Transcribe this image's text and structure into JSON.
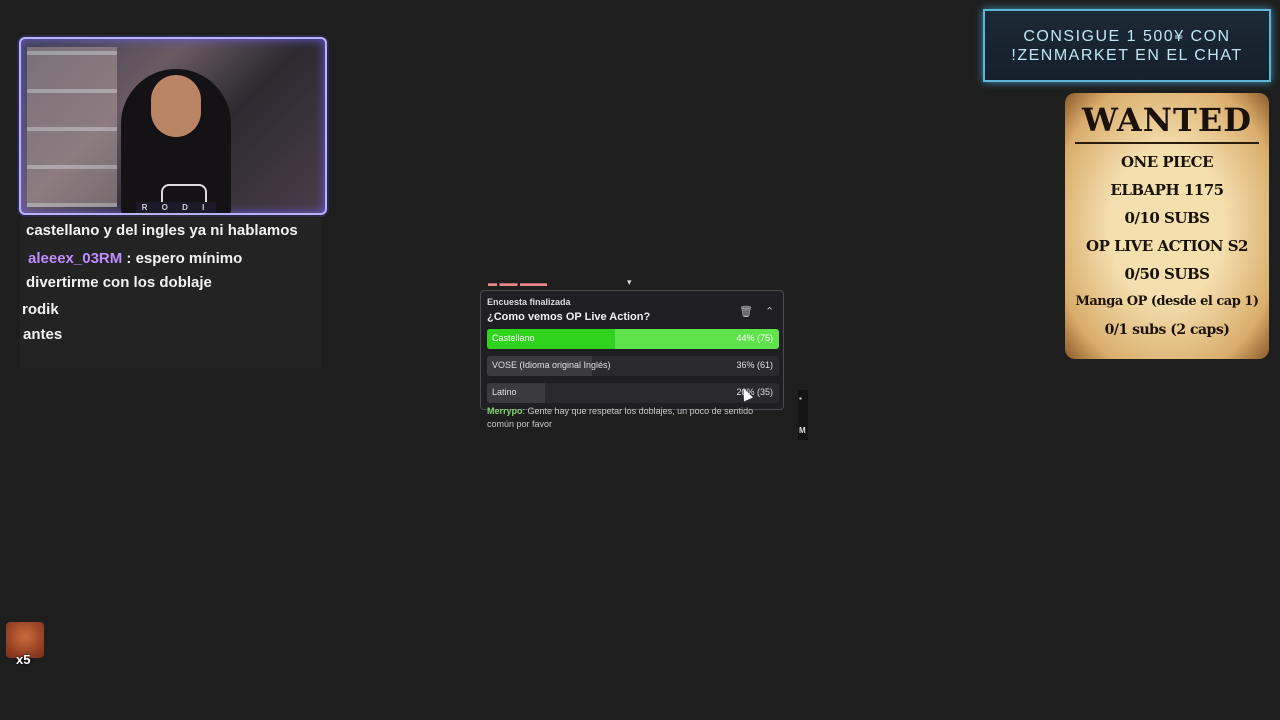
{
  "webcam": {
    "brand": "R O D I K"
  },
  "chat": {
    "lines": [
      {
        "text": "castellano y del ingles ya ni hablamos"
      },
      {
        "user": "aleeex_03RM",
        "text": " : espero mínimo"
      },
      {
        "text": "divertirme con los doblaje"
      },
      {
        "text": "rodik"
      },
      {
        "text": "antes"
      }
    ]
  },
  "poll": {
    "status": "Encuesta finalizada",
    "question": "¿Como vemos OP Live Action?",
    "options": [
      {
        "label": "Castellano",
        "result": "44% (75)",
        "percent": 44,
        "votes": 75
      },
      {
        "label": "VOSE (Idioma original Inglés)",
        "result": "36% (61)",
        "percent": 36,
        "votes": 61
      },
      {
        "label": "Latino",
        "result": "20% (35)",
        "percent": 20,
        "votes": 35
      }
    ],
    "bg_chat": {
      "user": "Merrypo",
      "message": ": Gente hay que respetar los doblajes, un poco de sentido",
      "message_cont": "común por favor"
    },
    "side_letters": [
      "M"
    ]
  },
  "promo": {
    "line1": "CONSIGUE 1 500¥ CON",
    "line2": "!ZENMARKET EN EL CHAT"
  },
  "wanted": {
    "title": "WANTED",
    "lines": [
      "ONE PIECE",
      "ELBAPH 1175",
      "0/10 SUBS",
      "OP LIVE ACTION S2",
      "0/50 SUBS",
      "Manga OP (desde el cap 1)",
      "0/1 subs (2 caps)"
    ]
  },
  "emote": {
    "count": "x5"
  },
  "icons": {
    "delete": "trash-icon",
    "collapse": "chevron-up-icon",
    "menu": "chevron-down-icon"
  }
}
